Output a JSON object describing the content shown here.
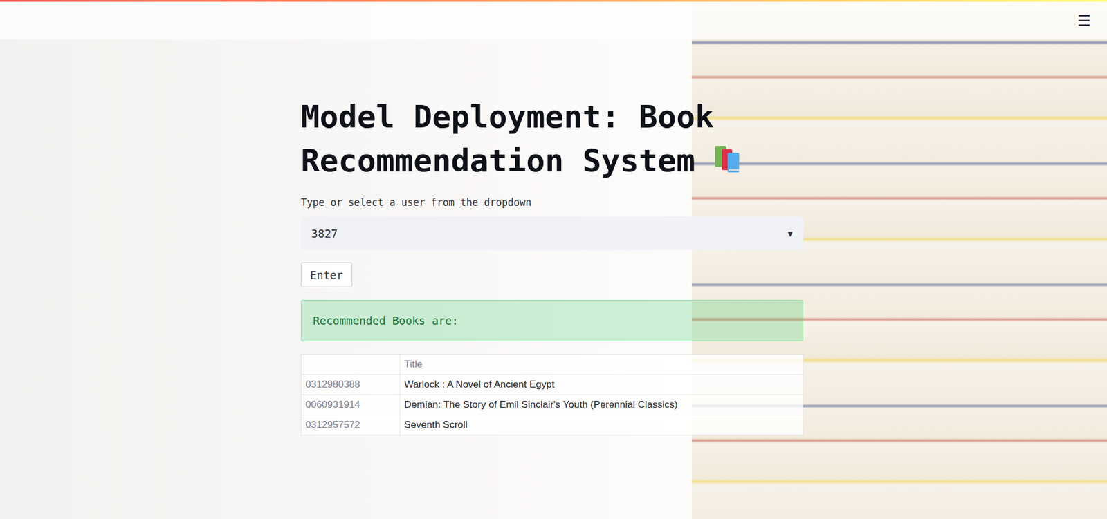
{
  "header": {
    "menu_icon": "☰"
  },
  "title": "Model Deployment: Book Recommendation System",
  "user_select": {
    "label": "Type or select a user from the dropdown",
    "value": "3827",
    "arrow": "▾"
  },
  "enter_button": {
    "label": "Enter"
  },
  "success": {
    "message": "Recommended Books are:"
  },
  "table": {
    "columns": [
      "",
      "Title"
    ],
    "rows": [
      {
        "index": "0312980388",
        "title": "Warlock : A Novel of Ancient Egypt"
      },
      {
        "index": "0060931914",
        "title": "Demian: The Story of Emil Sinclair's Youth (Perennial Classics)"
      },
      {
        "index": "0312957572",
        "title": "Seventh Scroll"
      }
    ]
  }
}
